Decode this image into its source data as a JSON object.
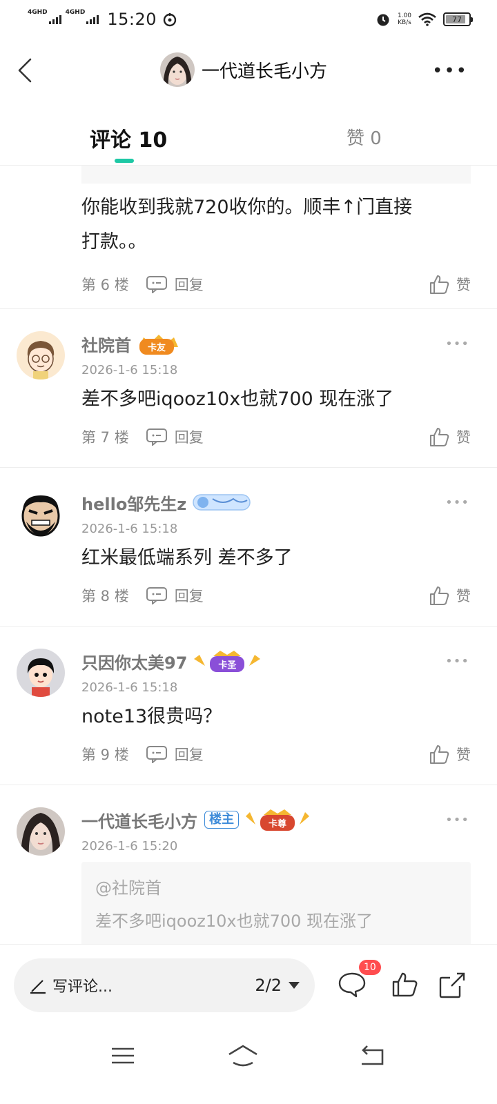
{
  "status_bar": {
    "signal1_label": "4GHD",
    "signal2_label": "4GHD",
    "time": "15:20",
    "net_speed_value": "1.00",
    "net_speed_unit": "KB/s",
    "battery": "77"
  },
  "header": {
    "title": "一代道长毛小方",
    "more": "•••"
  },
  "tabs": {
    "comments_label": "评论 10",
    "likes_label": "赞 0"
  },
  "top_partial": {
    "text_line1": "你能收到我就720收你的。顺丰↑门直接",
    "text_line2": "打款。。",
    "floor": "第 6 楼",
    "reply": "回复",
    "like": "赞"
  },
  "comments": [
    {
      "name": "社院首",
      "badge_text": "卡友",
      "date": "2026-1-6 15:18",
      "text": "差不多吧iqooz10x也就700 现在涨了",
      "floor": "第 7 楼",
      "reply": "回复",
      "like": "赞",
      "more": "•••"
    },
    {
      "name": "hello邹先生z",
      "date": "2026-1-6 15:18",
      "text": "红米最低端系列 差不多了",
      "floor": "第 8 楼",
      "reply": "回复",
      "like": "赞",
      "more": "•••"
    },
    {
      "name": "只因你太美97",
      "badge_text": "卡圣",
      "date": "2026-1-6 15:18",
      "text": "note13很贵吗？",
      "floor": "第 9 楼",
      "reply": "回复",
      "like": "赞",
      "more": "•••"
    },
    {
      "name": "一代道长毛小方",
      "host_badge": "楼主",
      "badge_text": "卡尊",
      "date": "2026-1-6 15:20",
      "quote_user": "@社院首",
      "quote_text": "差不多吧iqooz10x也就700 现在涨了",
      "more": "•••"
    }
  ],
  "bottom_bar": {
    "placeholder": "写评论...",
    "page": "2/2",
    "comment_count": "10"
  },
  "colors": {
    "accent": "#1ec8a5",
    "host_badge": "#3d8bd9",
    "notify_badge": "#ff4d4f"
  }
}
